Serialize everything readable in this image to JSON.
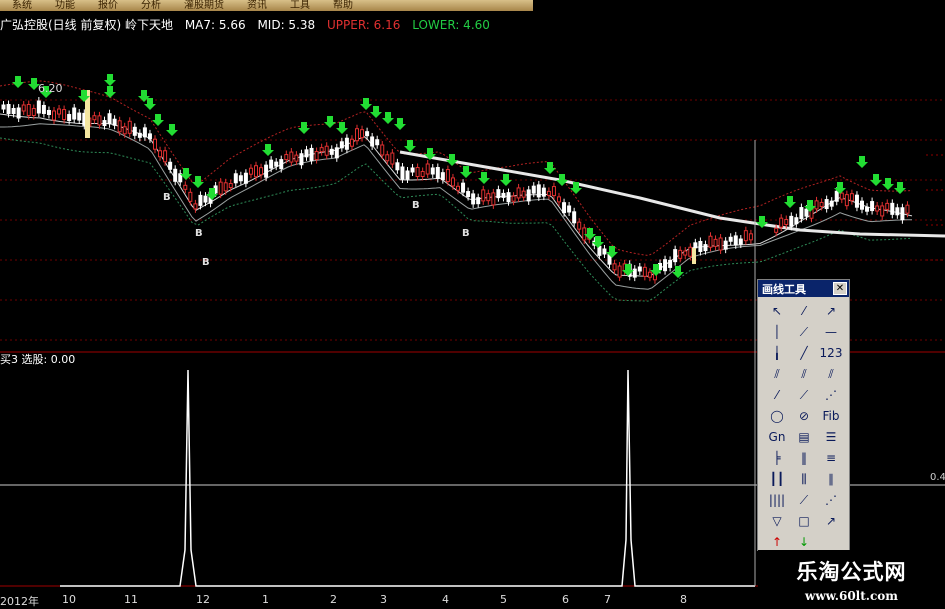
{
  "menu": [
    "系统",
    "功能",
    "报价",
    "分析",
    "灌股期货",
    "资讯",
    "工具",
    "帮助"
  ],
  "info": {
    "title": "广弘控股(日线 前复权) 岭下天地",
    "ma7": "MA7: 5.66",
    "mid": "MID: 5.38",
    "upper": "UPPER: 6.16",
    "lower": "LOWER: 4.60"
  },
  "price_label": "6.20",
  "buy_marker": "B",
  "indicator_label": "买3 选股: 0.00",
  "right_axis_label": "0.4",
  "date_axis": [
    "2012年",
    "10",
    "11",
    "12",
    "1",
    "2",
    "3",
    "4",
    "5",
    "6",
    "7",
    "8"
  ],
  "toolbox": {
    "title": "画线工具",
    "tools": [
      "arrow-pointer",
      "line-segment",
      "ray-line",
      "vertical-line",
      "line-2",
      "horizontal-line",
      "vertical-segment",
      "trend-line",
      "level-123",
      "parallel-line",
      "parallel-line-2",
      "parallel-line-3",
      "price-channel",
      "line-4",
      "gann-line",
      "circle",
      "circle-2",
      "fibonacci",
      "gann-fan",
      "parallel-channel",
      "fibonacci-2",
      "fib-time",
      "fan-lines",
      "parallel-bars",
      "cycle-lines",
      "fan-lines-2",
      "channel-lines",
      "bar-lines",
      "fan-grow",
      "speed-lines",
      "triangle",
      "rectangle",
      "line-arrow",
      "up-arrow",
      "down-arrow",
      "blank",
      "text-a",
      "text-label",
      "blank2",
      "cross-delete",
      "save",
      "clear"
    ]
  },
  "watermark": {
    "line1": "乐淘公式网",
    "line2": "www.60lt.com"
  },
  "colors": {
    "up": "#e03030",
    "down": "#ffffff",
    "marker": "#22dd33",
    "upper": "#b22222",
    "lower": "#2e8b57"
  }
}
